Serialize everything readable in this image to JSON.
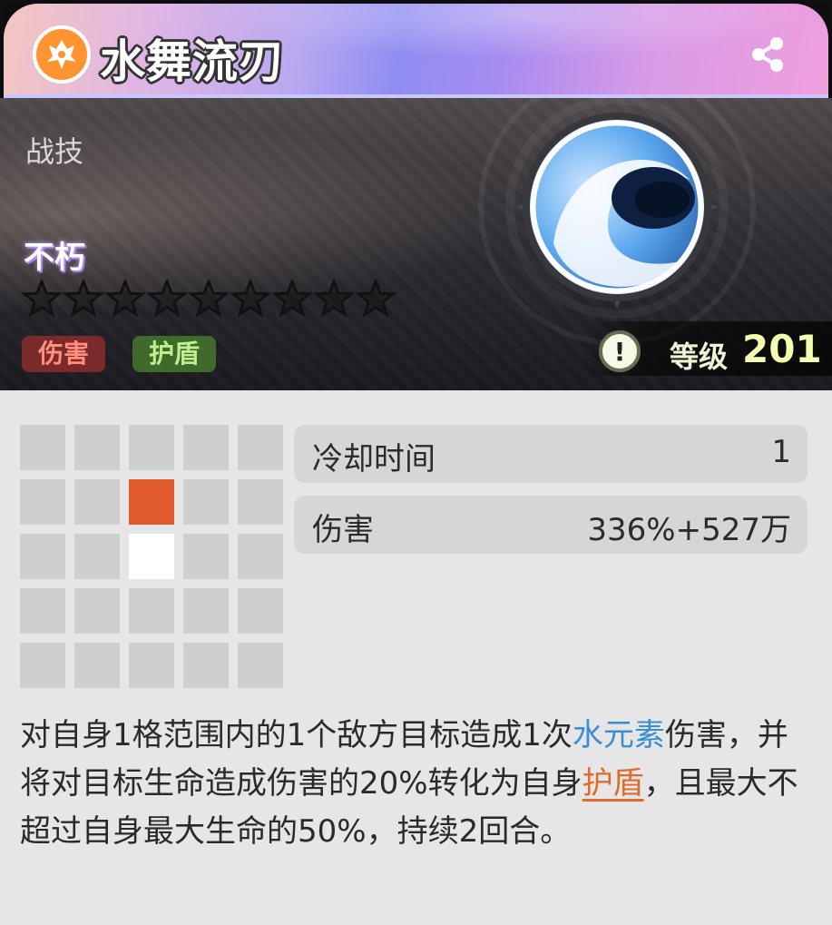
{
  "header": {
    "title": "水舞流刃",
    "emblem_icon": "fox-emblem-icon",
    "share_icon": "share-icon",
    "accent": "#ff9430"
  },
  "hero": {
    "skill_type": "战技",
    "tier": "不朽",
    "stars_total": 9,
    "stars_filled": 0,
    "tags": [
      {
        "label": "伤害",
        "color": "#ff8e7e"
      },
      {
        "label": "护盾",
        "color": "#bff08f"
      }
    ],
    "skill_icon": "water-wave-orb-icon",
    "info_icon": "!",
    "level_label": "等级",
    "level_value": "201"
  },
  "range_grid": {
    "rows": 5,
    "cols": 5,
    "cells": [
      0,
      0,
      0,
      0,
      0,
      0,
      0,
      2,
      0,
      0,
      0,
      0,
      1,
      0,
      0,
      0,
      0,
      0,
      0,
      0,
      0,
      0,
      0,
      0,
      0
    ],
    "target_color": "#e05a2d",
    "self_color": "#ffffff"
  },
  "stats": [
    {
      "label": "冷却时间",
      "value": "1"
    },
    {
      "label": "伤害",
      "value": "336%+527万"
    }
  ],
  "description": {
    "p1": "对自身1格范围内的1个敌方目标造成1次",
    "water_element": "水元素",
    "p2": "伤害，并将对目标生命造成伤害的20%转化为自身",
    "shield": "护盾",
    "p3": "，且最大不超过自身最大生命的50%，持续2回合。"
  }
}
